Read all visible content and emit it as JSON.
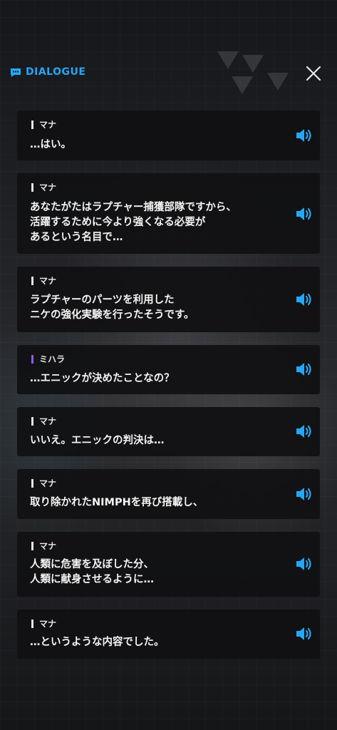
{
  "header": {
    "title": "DIALOGUE",
    "icon": "chat-bubble-icon",
    "close_icon": "close-icon",
    "accent_color": "#27a6f2"
  },
  "dialogue": [
    {
      "speaker": "マナ",
      "text": "…はい。"
    },
    {
      "speaker": "マナ",
      "text": "あなたがたはラプチャー捕獲部隊ですから、\n活躍するために今より強くなる必要が\nあるという名目で…"
    },
    {
      "speaker": "マナ",
      "text": "ラプチャーのパーツを利用した\nニケの強化実験を行ったそうです。"
    },
    {
      "speaker": "ミハラ",
      "text": "…エニックが決めたことなの？"
    },
    {
      "speaker": "マナ",
      "text": "いいえ。エニックの判決は…"
    },
    {
      "speaker": "マナ",
      "text": "取り除かれたNIMPHを再び搭載し、"
    },
    {
      "speaker": "マナ",
      "text": "人類に危害を及ぼした分、\n人類に献身させるように…"
    },
    {
      "speaker": "マナ",
      "text": "…というような内容でした。"
    }
  ],
  "speaker_colors": {
    "マナ": "#e6e6e6",
    "ミハラ": "#8a5cf5"
  },
  "voice_icon": "speaker-icon"
}
